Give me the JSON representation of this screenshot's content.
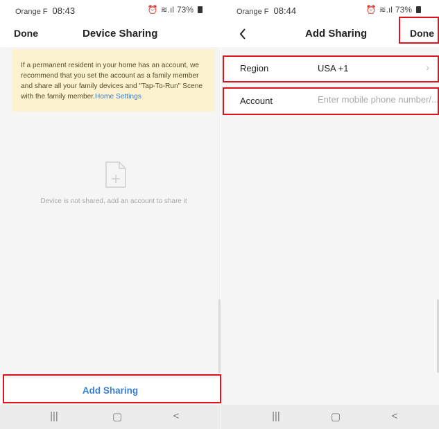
{
  "left_screen": {
    "status": {
      "carrier": "Orange F",
      "time": "08:43",
      "battery": "73%"
    },
    "header": {
      "done_label": "Done",
      "title": "Device Sharing"
    },
    "banner": {
      "text": "If a permanent resident in your home has an account, we recommend that you set the account as a family member and share all your family devices and \"Tap-To-Run\" Scene with the family member.",
      "link_label": "Home Settings"
    },
    "empty_state": {
      "icon": "file-plus-icon",
      "message": "Device is not shared, add an account to share it"
    },
    "bottom_button_label": "Add Sharing",
    "system_nav": {
      "recents": "|||",
      "home": "▢",
      "back": "<"
    }
  },
  "right_screen": {
    "status": {
      "carrier": "Orange F",
      "time": "08:44",
      "battery": "73%"
    },
    "header": {
      "back_icon": "chevron-left-icon",
      "title": "Add Sharing",
      "done_label": "Done"
    },
    "region": {
      "label": "Region",
      "value": "USA +1"
    },
    "account": {
      "label": "Account",
      "value": "",
      "placeholder": "Enter mobile phone number/..."
    },
    "system_nav": {
      "recents": "|||",
      "home": "▢",
      "back": "<"
    }
  },
  "colors": {
    "accent": "#3a7fd0",
    "highlight": "#e0121b",
    "banner_bg": "#fcf2d0"
  }
}
